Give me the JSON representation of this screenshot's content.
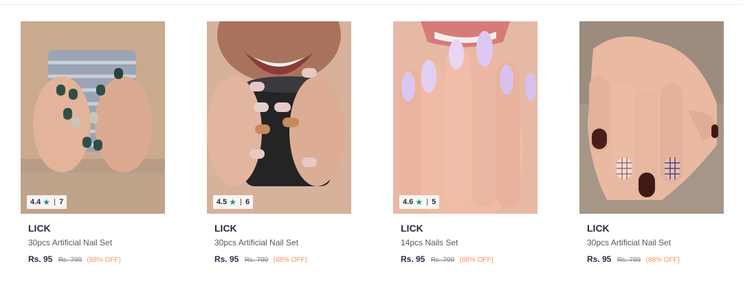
{
  "products": [
    {
      "brand": "LICK",
      "name": "30pcs Artificial Nail Set",
      "price": "Rs. 95",
      "mrp": "Rs. 799",
      "discount": "(88% OFF)",
      "rating": "4.4",
      "rating_count": "7",
      "has_rating": true,
      "image": "hands-holding-mug-green-nails"
    },
    {
      "brand": "LICK",
      "name": "30pcs Artificial Nail Set",
      "price": "Rs. 95",
      "mrp": "Rs. 799",
      "discount": "(88% OFF)",
      "rating": "4.5",
      "rating_count": "6",
      "has_rating": true,
      "image": "smiling-woman-black-mug-pink-glitter-nails"
    },
    {
      "brand": "LICK",
      "name": "14pcs Nails Set",
      "price": "Rs. 95",
      "mrp": "Rs. 799",
      "discount": "(88% OFF)",
      "rating": "4.6",
      "rating_count": "5",
      "has_rating": true,
      "image": "hands-near-lips-holographic-nails"
    },
    {
      "brand": "LICK",
      "name": "30pcs Artificial Nail Set",
      "price": "Rs. 95",
      "mrp": "Rs. 799",
      "discount": "(88% OFF)",
      "has_rating": false,
      "image": "hand-brown-plaid-nails"
    }
  ],
  "icons": {
    "star": "star-icon"
  },
  "colors": {
    "rating_star": "#14958f",
    "discount": "#ff905a",
    "text_primary": "#282c3f",
    "text_secondary": "#535766"
  }
}
